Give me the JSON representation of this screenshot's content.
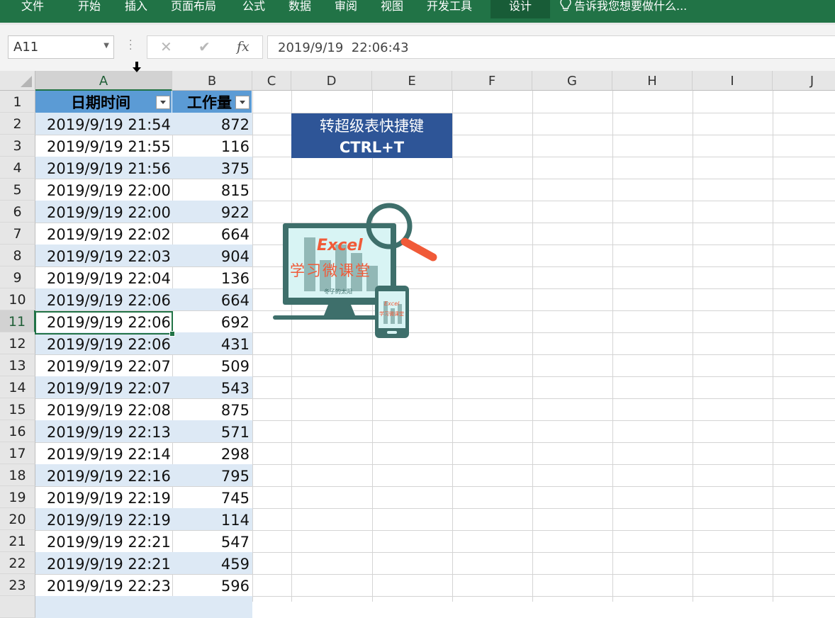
{
  "ribbon": {
    "tabs": [
      "文件",
      "开始",
      "插入",
      "页面布局",
      "公式",
      "数据",
      "审阅",
      "视图",
      "开发工具",
      "设计"
    ],
    "active_tab": "设计",
    "tell_me": "告诉我您想要做什么..."
  },
  "formula_bar": {
    "name_box": "A11",
    "content": "2019/9/19  22:06:43",
    "cancel_icon": "✕",
    "enter_icon": "✔",
    "fx_icon": "fx"
  },
  "sheet": {
    "columns": [
      "A",
      "B",
      "C",
      "D",
      "E",
      "F",
      "G",
      "H",
      "I",
      "J"
    ],
    "selected_column": "A",
    "selected_row": "11",
    "rows": [
      "1",
      "2",
      "3",
      "4",
      "5",
      "6",
      "7",
      "8",
      "9",
      "10",
      "11",
      "12",
      "13",
      "14",
      "15",
      "16",
      "17",
      "18",
      "19",
      "20",
      "21",
      "22",
      "23"
    ]
  },
  "table": {
    "headers": [
      "日期时间",
      "工作量"
    ],
    "rows": [
      [
        "2019/9/19 21:54",
        "872"
      ],
      [
        "2019/9/19 21:55",
        "116"
      ],
      [
        "2019/9/19 21:56",
        "375"
      ],
      [
        "2019/9/19 22:00",
        "815"
      ],
      [
        "2019/9/19 22:00",
        "922"
      ],
      [
        "2019/9/19 22:02",
        "664"
      ],
      [
        "2019/9/19 22:03",
        "904"
      ],
      [
        "2019/9/19 22:04",
        "136"
      ],
      [
        "2019/9/19 22:06",
        "664"
      ],
      [
        "2019/9/19 22:06",
        "692"
      ],
      [
        "2019/9/19 22:06",
        "431"
      ],
      [
        "2019/9/19 22:07",
        "509"
      ],
      [
        "2019/9/19 22:07",
        "543"
      ],
      [
        "2019/9/19 22:08",
        "875"
      ],
      [
        "2019/9/19 22:13",
        "571"
      ],
      [
        "2019/9/19 22:14",
        "298"
      ],
      [
        "2019/9/19 22:16",
        "795"
      ],
      [
        "2019/9/19 22:19",
        "745"
      ],
      [
        "2019/9/19 22:19",
        "114"
      ],
      [
        "2019/9/19 22:21",
        "547"
      ],
      [
        "2019/9/19 22:21",
        "459"
      ],
      [
        "2019/9/19 22:23",
        "596"
      ]
    ]
  },
  "shortcut_box": {
    "line1": "转超级表快捷键",
    "line2": "CTRL+T"
  },
  "logo": {
    "title": "Excel",
    "subtitle": "学习微课堂",
    "caption": "冬子的太阳",
    "phone_title": "Excel",
    "phone_subtitle": "学习微课堂"
  },
  "colors": {
    "ribbon": "#217346",
    "table_header": "#5b9bd5",
    "table_band": "#dde9f5",
    "shortcut_box": "#2e5597",
    "logo_accent": "#f05a38"
  }
}
